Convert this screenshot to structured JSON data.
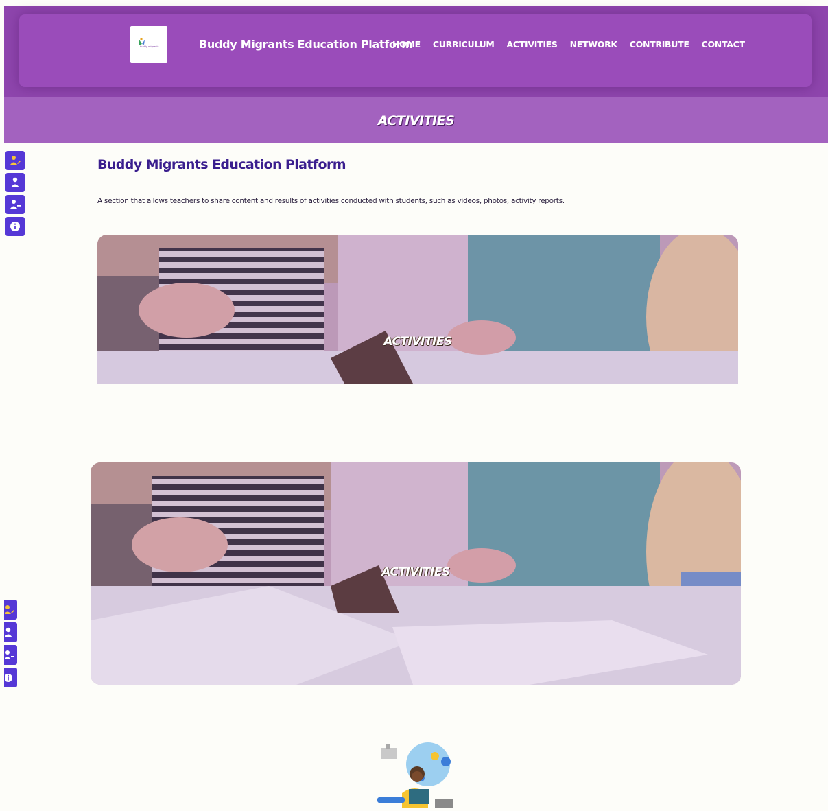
{
  "header": {
    "logo_alt": "buddy migrants",
    "brand_title": "Buddy Migrants Education Platform",
    "nav": [
      {
        "label": "HOME"
      },
      {
        "label": "CURRICULUM"
      },
      {
        "label": "ACTIVITIES"
      },
      {
        "label": "NETWORK"
      },
      {
        "label": "CONTRIBUTE"
      },
      {
        "label": "CONTACT"
      }
    ]
  },
  "banner": {
    "title": "ACTIVITIES"
  },
  "sidebar": {
    "icons": [
      "user-edit-icon",
      "user-icon",
      "user-minus-icon",
      "info-icon"
    ],
    "color": "#5538d6"
  },
  "main": {
    "title": "Buddy Migrants Education Platform",
    "description": "A section that allows teachers to share content and results of activities conducted with students, such as videos, photos, activity reports.",
    "cards": [
      {
        "label": "ACTIVITIES"
      },
      {
        "label": "ACTIVITIES"
      }
    ]
  },
  "colors": {
    "header": "#8e45ad",
    "banner": "#a362bf",
    "title": "#3a1e8e",
    "background": "#fdfdf9"
  }
}
